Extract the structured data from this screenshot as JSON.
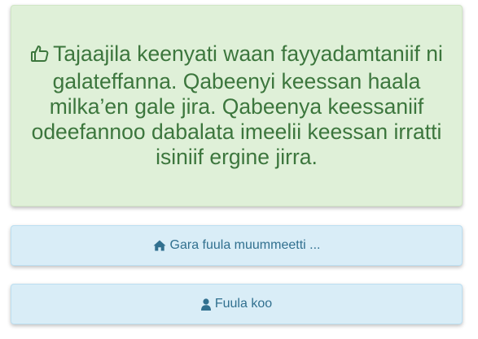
{
  "alert": {
    "icon": "thumbs-up-icon",
    "message": "Tajaajila keenyati waan fayyadamtaniif ni galateffanna. Qabeenyi keessan haala milka’en gale jira. Qabeenya keessaniif odeefannoo dabalata imeelii keessan irratti isiniif ergine jirra."
  },
  "actions": {
    "home_label": "Gara fuula muummeetti ...",
    "home_icon": "home-icon",
    "user_label": "Fuula koo",
    "user_icon": "user-icon"
  },
  "colors": {
    "success_bg": "#dff0d8",
    "success_text": "#3c763d",
    "info_bg": "#d9edf7",
    "info_text": "#31708f"
  }
}
